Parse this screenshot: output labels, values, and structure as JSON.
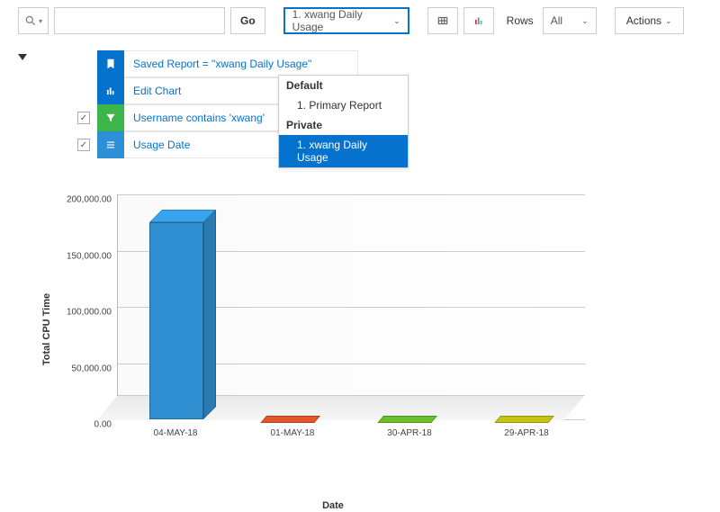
{
  "toolbar": {
    "go_label": "Go",
    "report_select_label": "1. xwang Daily Usage",
    "rows_label": "Rows",
    "rows_value": "All",
    "actions_label": "Actions"
  },
  "dropdown": {
    "group1_label": "Default",
    "group1_items": [
      "1. Primary Report"
    ],
    "group2_label": "Private",
    "group2_items": [
      "1. xwang Daily Usage"
    ]
  },
  "filters": {
    "saved_report": "Saved Report = \"xwang Daily Usage\"",
    "edit_chart": "Edit Chart",
    "username": "Username contains 'xwang'",
    "usage_date": "Usage Date"
  },
  "chart_data": {
    "type": "bar",
    "title": "",
    "xlabel": "Date",
    "ylabel": "Total CPU Time",
    "ylim": [
      0,
      200000
    ],
    "y_ticks": [
      0,
      50000,
      100000,
      150000,
      200000
    ],
    "y_tick_labels": [
      "0.00",
      "50,000.00",
      "100,000.00",
      "150,000.00",
      "200,000.00"
    ],
    "categories": [
      "04-MAY-18",
      "01-MAY-18",
      "30-APR-18",
      "29-APR-18"
    ],
    "values": [
      175000,
      0,
      0,
      0
    ],
    "colors": [
      "#2f8fd0",
      "#e2572a",
      "#6cbf2a",
      "#c4c417"
    ]
  }
}
